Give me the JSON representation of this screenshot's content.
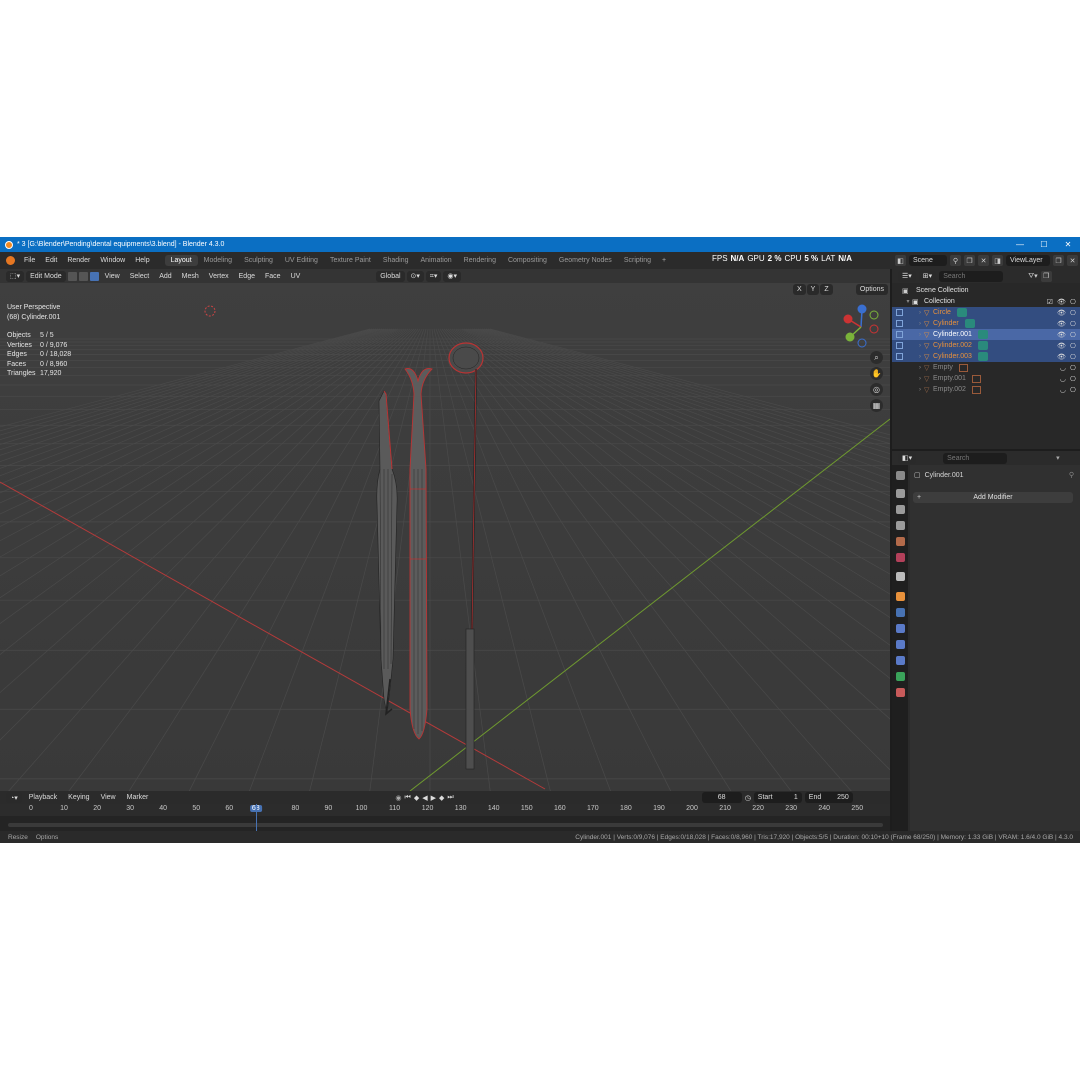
{
  "window": {
    "title": "* 3 [G:\\Blender\\Pending\\dental equipments\\3.blend] - Blender 4.3.0",
    "controls": [
      "—",
      "☐",
      "✕"
    ]
  },
  "menu": {
    "items": [
      "File",
      "Edit",
      "Render",
      "Window",
      "Help"
    ]
  },
  "workspaces": {
    "tabs": [
      "Layout",
      "Modeling",
      "Sculpting",
      "UV Editing",
      "Texture Paint",
      "Shading",
      "Animation",
      "Rendering",
      "Compositing",
      "Geometry Nodes",
      "Scripting"
    ],
    "active": "Layout",
    "add": "+"
  },
  "perf": {
    "fps_label": "FPS",
    "fps": "N/A",
    "gpu_label": "GPU",
    "gpu": "2 %",
    "cpu_label": "CPU",
    "cpu": "5 %",
    "lat_label": "LAT",
    "lat": "N/A"
  },
  "scene": {
    "name": "Scene",
    "view_layer": "ViewLayer"
  },
  "viewport": {
    "mode": "Edit Mode",
    "menus": [
      "View",
      "Select",
      "Add",
      "Mesh",
      "Vertex",
      "Edge",
      "Face",
      "UV"
    ],
    "orientation": "Global",
    "options_label": "Options",
    "axes": [
      "X",
      "Y",
      "Z"
    ],
    "perspective": "User Perspective",
    "active_object": "(68) Cylinder.001",
    "stats": [
      {
        "label": "Objects",
        "value": "5 / 5"
      },
      {
        "label": "Vertices",
        "value": "0 / 9,076"
      },
      {
        "label": "Edges",
        "value": "0 / 18,028"
      },
      {
        "label": "Faces",
        "value": "0 / 8,960"
      },
      {
        "label": "Triangles",
        "value": "17,920"
      }
    ]
  },
  "timeline": {
    "menus": [
      "Playback",
      "Keying",
      "View",
      "Marker"
    ],
    "current_frame": "68",
    "start_label": "Start",
    "start": "1",
    "end_label": "End",
    "end": "250",
    "ticks": [
      "0",
      "10",
      "20",
      "30",
      "40",
      "50",
      "60",
      "80",
      "90",
      "100",
      "110",
      "120",
      "130",
      "140",
      "150",
      "160",
      "170",
      "180",
      "190",
      "200",
      "210",
      "220",
      "230",
      "240",
      "250"
    ],
    "playhead_label": "68"
  },
  "outliner": {
    "search_placeholder": "Search",
    "scene_collection": "Scene Collection",
    "collection": "Collection",
    "items": [
      {
        "name": "Circle",
        "kind": "mesh",
        "selected": true
      },
      {
        "name": "Cylinder",
        "kind": "mesh",
        "selected": true
      },
      {
        "name": "Cylinder.001",
        "kind": "mesh",
        "selected": true,
        "active": true
      },
      {
        "name": "Cylinder.002",
        "kind": "mesh",
        "selected": true
      },
      {
        "name": "Cylinder.003",
        "kind": "mesh",
        "selected": true
      },
      {
        "name": "Empty",
        "kind": "empty",
        "selected": false
      },
      {
        "name": "Empty.001",
        "kind": "empty",
        "selected": false
      },
      {
        "name": "Empty.002",
        "kind": "empty",
        "selected": false
      }
    ]
  },
  "properties": {
    "search_placeholder": "Search",
    "object_name": "Cylinder.001",
    "add_modifier": "Add Modifier"
  },
  "status": {
    "left": [
      "Resize",
      "Options"
    ],
    "right": "Cylinder.001 | Verts:0/9,076 | Edges:0/18,028 | Faces:0/8,960 | Tris:17,920 | Objects:5/5 | Duration: 00:10+10 (Frame 68/250) | Memory: 1.33 GiB | VRAM: 1.6/4.0 GiB | 4.3.0"
  },
  "colors": {
    "accent": "#4772b3",
    "titlebar": "#0b6fc3",
    "selection_outline": "#e8913b",
    "x_axis": "#c83a3a",
    "y_axis": "#7fa33a"
  }
}
